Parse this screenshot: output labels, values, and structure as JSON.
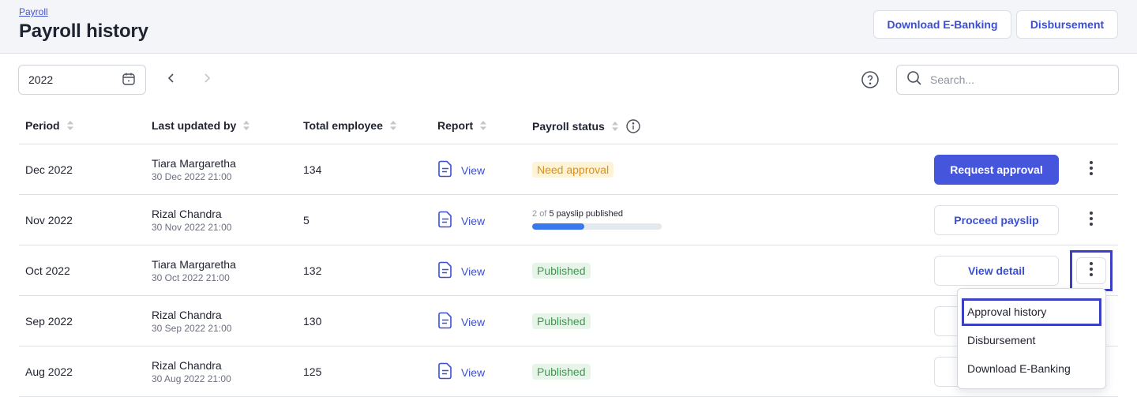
{
  "header": {
    "breadcrumb": "Payroll",
    "title": "Payroll history",
    "download_ebanking_label": "Download E-Banking",
    "disbursement_label": "Disbursement"
  },
  "filters": {
    "year": "2022",
    "search_placeholder": "Search..."
  },
  "icons": {
    "calendar": "calendar-icon",
    "prev": "chevron-left-icon",
    "next": "chevron-right-icon",
    "help": "help-circle-icon",
    "search": "search-icon",
    "sort": "sort-icon",
    "info": "info-icon",
    "report": "document-icon",
    "more": "kebab-menu-icon"
  },
  "table": {
    "columns": [
      "Period",
      "Last updated by",
      "Total employee",
      "Report",
      "Payroll status"
    ],
    "rows": [
      {
        "period": "Dec 2022",
        "updated_by": "Tiara Margaretha",
        "updated_at": "30 Dec 2022 21:00",
        "total": "134",
        "report": "View",
        "status": "Need approval",
        "action": "Request approval"
      },
      {
        "period": "Nov 2022",
        "updated_by": "Rizal Chandra",
        "updated_at": "30 Nov 2022 21:00",
        "total": "5",
        "report": "View",
        "progress_done": "2",
        "progress_of": "of",
        "progress_total": "5 payslip published",
        "action": "Proceed payslip"
      },
      {
        "period": "Oct 2022",
        "updated_by": "Tiara Margaretha",
        "updated_at": "30 Oct 2022 21:00",
        "total": "132",
        "report": "View",
        "status": "Published",
        "action": "View detail"
      },
      {
        "period": "Sep 2022",
        "updated_by": "Rizal Chandra",
        "updated_at": "30 Sep 2022 21:00",
        "total": "130",
        "report": "View",
        "status": "Published"
      },
      {
        "period": "Aug 2022",
        "updated_by": "Rizal Chandra",
        "updated_at": "30 Aug 2022 21:00",
        "total": "125",
        "report": "View",
        "status": "Published"
      }
    ]
  },
  "progress_fraction": 0.4,
  "menu": {
    "items": [
      "Approval history",
      "Disbursement",
      "Download E-Banking"
    ]
  },
  "colors": {
    "accent": "#4656dc",
    "need_approval": "#d9901a",
    "published": "#3a9a4c",
    "progress": "#3a78f0",
    "highlight": "#3b3fc4"
  }
}
